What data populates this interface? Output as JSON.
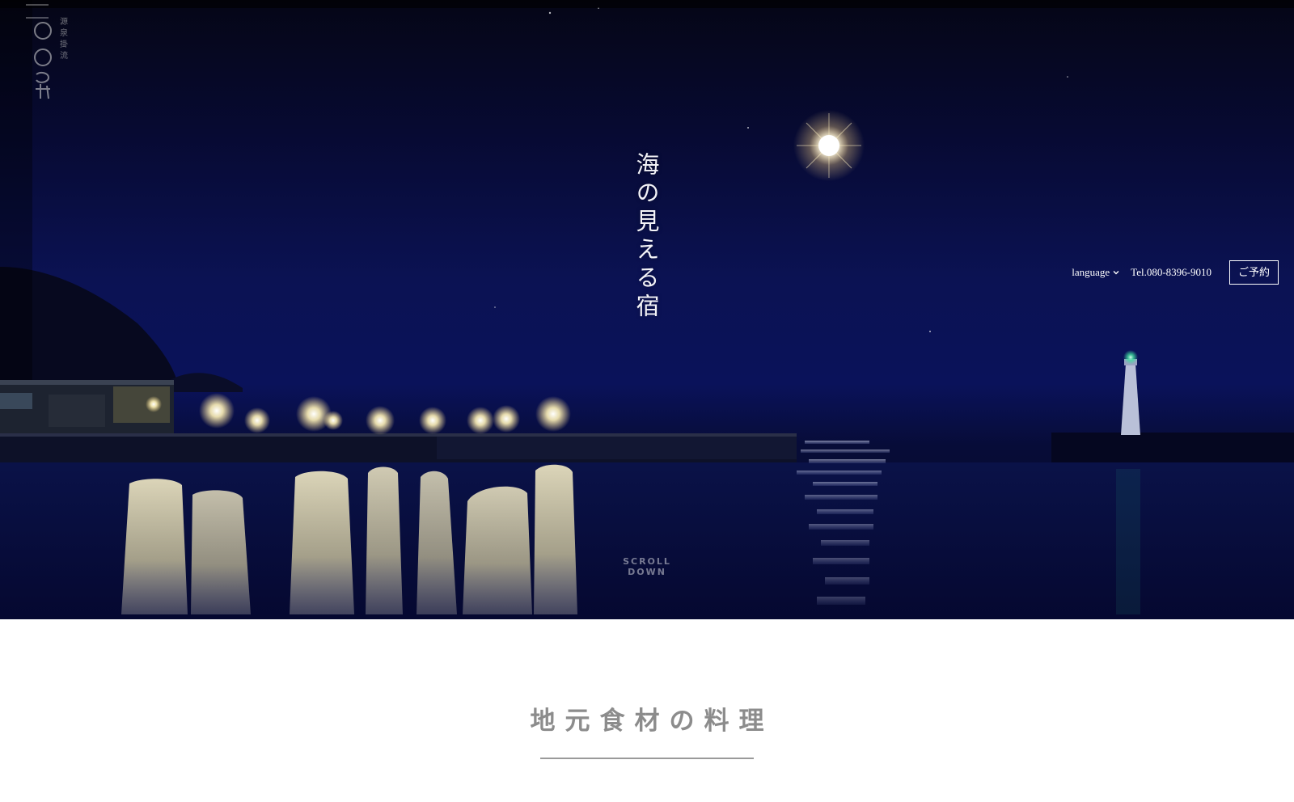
{
  "logo": {
    "text": "〇〇の湯",
    "subtext": "源泉掛け流し"
  },
  "hero": {
    "tagline": "海の見える宿",
    "scroll_label": "SCROLL DOWN"
  },
  "header": {
    "language_label": "language",
    "phone": "Tel.080-8396-9010",
    "reserve_label": "ご予約"
  },
  "section": {
    "title": "地元食材の料理"
  }
}
